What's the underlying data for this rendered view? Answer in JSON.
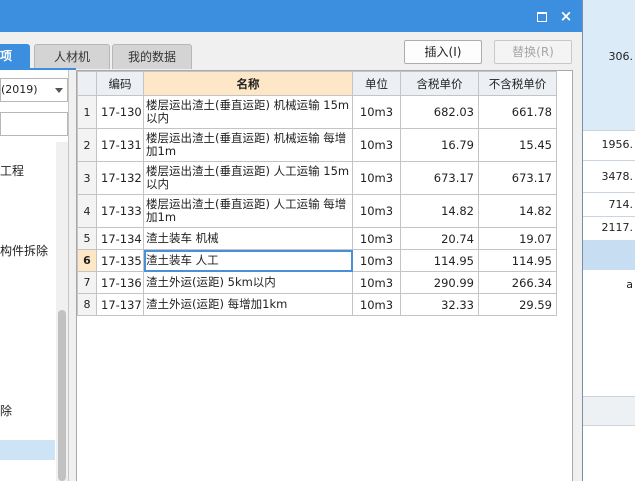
{
  "background_app": {
    "values": [
      "306.",
      "1956.",
      "3478.",
      "714.",
      "2117.",
      "a"
    ]
  },
  "dialog": {
    "titlebar": {
      "maximize_icon": "maximize-icon",
      "close_glyph": "×"
    },
    "tabs": [
      {
        "label": "项",
        "active": true
      },
      {
        "label": "人材机",
        "active": false
      },
      {
        "label": "我的数据",
        "active": false
      }
    ],
    "buttons": {
      "insert": "插入(I)",
      "replace": "替换(R)"
    },
    "left_panel": {
      "select_value": "(2019)",
      "tree_items": [
        "工程",
        "构件拆除",
        "除"
      ]
    },
    "grid": {
      "headers": [
        "编码",
        "名称",
        "单位",
        "含税单价",
        "不含税单价"
      ],
      "rows": [
        {
          "idx": "1",
          "code": "17-130",
          "name": "楼层运出渣土(垂直运距) 机械运输 15m以内",
          "unit": "10m3",
          "tax_price": "682.03",
          "notax_price": "661.78"
        },
        {
          "idx": "2",
          "code": "17-131",
          "name": "楼层运出渣土(垂直运距) 机械运输 每增加1m",
          "unit": "10m3",
          "tax_price": "16.79",
          "notax_price": "15.45"
        },
        {
          "idx": "3",
          "code": "17-132",
          "name": "楼层运出渣土(垂直运距) 人工运输 15m以内",
          "unit": "10m3",
          "tax_price": "673.17",
          "notax_price": "673.17"
        },
        {
          "idx": "4",
          "code": "17-133",
          "name": "楼层运出渣土(垂直运距) 人工运输 每增加1m",
          "unit": "10m3",
          "tax_price": "14.82",
          "notax_price": "14.82"
        },
        {
          "idx": "5",
          "code": "17-134",
          "name": "渣土装车 机械",
          "unit": "10m3",
          "tax_price": "20.74",
          "notax_price": "19.07"
        },
        {
          "idx": "6",
          "code": "17-135",
          "name": "渣土装车 人工",
          "unit": "10m3",
          "tax_price": "114.95",
          "notax_price": "114.95"
        },
        {
          "idx": "7",
          "code": "17-136",
          "name": "渣土外运(运距) 5km以内",
          "unit": "10m3",
          "tax_price": "290.99",
          "notax_price": "266.34"
        },
        {
          "idx": "8",
          "code": "17-137",
          "name": "渣土外运(运距) 每增加1km",
          "unit": "10m3",
          "tax_price": "32.33",
          "notax_price": "29.59"
        }
      ],
      "selected_row_index": 5
    }
  },
  "colors": {
    "accent": "#3c8fde",
    "header_highlight": "#fde7c6",
    "selection": "#cde4f7"
  }
}
